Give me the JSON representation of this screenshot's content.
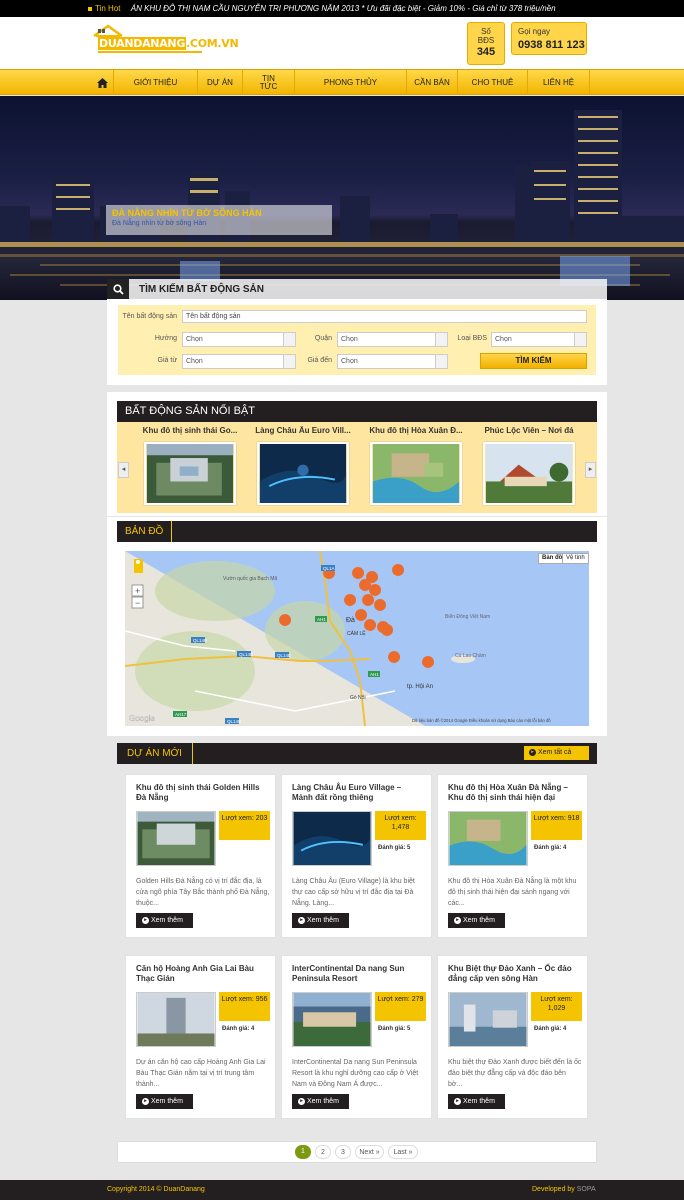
{
  "topbar": {
    "tag": "Tin Hot",
    "news": "ÁN KHU ĐÔ THỊ NAM CẦU NGUYỄN TRI PHƯƠNG NĂM 2013 * Ưu đãi đặc biệt - Giảm 10% - Giá chỉ từ 378 triệu/nền"
  },
  "logo": {
    "text1": "DUANDANANG",
    "text2": ".COM.VN"
  },
  "stats": {
    "label": "Số BĐS",
    "count": "345"
  },
  "contact": {
    "label": "Gọi ngay",
    "phone": "0938 811 123"
  },
  "nav": [
    "GIỚI THIỆU",
    "DỰ ÁN",
    "TIN TỨC",
    "PHONG THỦY",
    "CẦN BÁN",
    "CHO THUÊ",
    "LIÊN HỆ"
  ],
  "banner": {
    "title": "ĐÀ NẴNG NHÌN TỪ BỜ SÔNG HÀN",
    "subtitle": "Đà Nẵng nhìn từ bờ sông Hàn"
  },
  "search": {
    "title": "TÌM KIẾM BẤT ĐỘNG SẢN",
    "name_label": "Tên bất động sản",
    "name_value": "Tên bất động sản",
    "direction_label": "Hướng",
    "district_label": "Quận",
    "type_label": "Loại BĐS",
    "price_from_label": "Giá từ",
    "price_to_label": "Giá đến",
    "choose": "Chọn",
    "button": "TÌM KIẾM"
  },
  "featured": {
    "title": "BẤT ĐỘNG SẢN NỔI BẬT",
    "items": [
      "Khu đô thị sinh thái Go...",
      "Làng Châu Âu Euro Vill...",
      "Khu đô thị Hòa Xuân Đ...",
      "Phúc Lộc Viên – Nơi đá"
    ]
  },
  "map": {
    "title": "BẢN ĐỒ",
    "btn_map": "Bản đồ",
    "btn_sat": "Vệ tinh",
    "labels": {
      "park": "Vườn quốc gia Bạch Mã",
      "sea": "Biển Đông Việt Nam",
      "island": "Cù Lao Chàm",
      "hoian": "tp. Hội An",
      "danang": "Đà",
      "gonoi": "Gò Nổi",
      "camle": "CẨM LỆ"
    },
    "roads": [
      "QL14B",
      "QL14B",
      "QL14B",
      "QL1A",
      "AH1",
      "AH17",
      "AH1",
      "QL14B"
    ],
    "footer": "Dữ liệu bản đồ ©2014 Google   Điều khoản sử dụng   Báo cáo một lỗi bản đồ",
    "google": "Google"
  },
  "projects": {
    "title": "DỰ ÁN MỚI",
    "view_all": "Xem tất cả",
    "views_label": "Lượt xem:",
    "rating_label": "Đánh giá:",
    "more": "Xem thêm",
    "items": [
      {
        "title": "Khu đô thị sinh thái Golden Hills Đà Nẵng",
        "views": "203",
        "rating": "",
        "desc": "Golden Hills Đà Nẵng có vị trí đắc địa, là cửa ngõ phía Tây Bắc thành phố Đà Nẵng, thuộc..."
      },
      {
        "title": "Làng Châu Âu Euro Village – Mảnh đất rồng thiêng",
        "views": "1,478",
        "rating": "5",
        "desc": "Làng Châu Âu (Euro Village) là khu biệt thự cao cấp sở hữu vị trí đắc địa tại Đà Nẵng. Làng..."
      },
      {
        "title": "Khu đô thị Hòa Xuân Đà Nẵng – Khu đô thị sinh thái hiện đại",
        "views": "918",
        "rating": "4",
        "desc": "Khu đô thị Hòa Xuân Đà Nẵng là một khu đô thị sinh thái hiện đại sánh ngang với các..."
      },
      {
        "title": "Căn hộ Hoàng Anh Gia Lai Bàu Thạc Gián",
        "views": "956",
        "rating": "4",
        "desc": "Dự án căn hộ cao cấp Hoàng Anh Gia Lai Bàu Thạc Gián nằm tại vị trí trung tâm thành..."
      },
      {
        "title": "InterContinental Da nang Sun Peninsula Resort",
        "views": "279",
        "rating": "5",
        "desc": "InterContinental Da nang Sun Peninsula Resort là khu nghỉ dưỡng cao cấp ở Việt Nam và Đông Nam Á được..."
      },
      {
        "title": "Khu Biệt thự Đảo Xanh – Ốc đảo đẳng cấp ven sông Hàn",
        "views": "1,029",
        "rating": "4",
        "desc": "Khu biệt thự Đảo Xanh được biết đến là ốc đảo biệt thự đẳng cấp và độc đáo bên bờ..."
      }
    ]
  },
  "pagination": [
    "1",
    "2",
    "3",
    "Next »",
    "Last »"
  ],
  "footer": {
    "copyright": "Copyright 2014 © DuanDanang",
    "developed": "Developed by",
    "dev_name": "SOPA"
  },
  "colors": {
    "accent": "#f5c400",
    "dark": "#231f20"
  }
}
